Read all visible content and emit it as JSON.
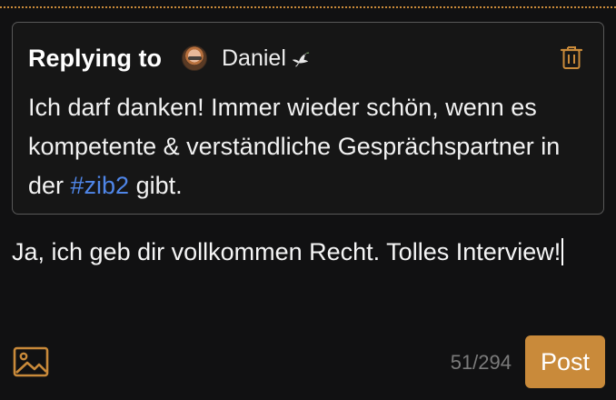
{
  "colors": {
    "accent": "#c98a3a",
    "hashtag": "#4f86e8",
    "background": "#111112",
    "card_border": "#595959",
    "muted_text": "#7b7b7b"
  },
  "reply": {
    "label": "Replying to",
    "author_name": "Daniel",
    "author_badge_icon": "dove-icon",
    "avatar_icon": "avatar-icon",
    "delete_icon": "trash-icon",
    "body_before": "Ich darf danken! Immer wieder schön, wenn es kompetente & verständliche Gesprächspartner in der ",
    "hashtag": "#zib2",
    "body_after": " gibt."
  },
  "composer": {
    "text": "Ja, ich geb dir vollkommen Recht. Tolles Interview!"
  },
  "toolbar": {
    "image_icon": "image-icon",
    "char_counter": "51/294",
    "post_label": "Post"
  }
}
